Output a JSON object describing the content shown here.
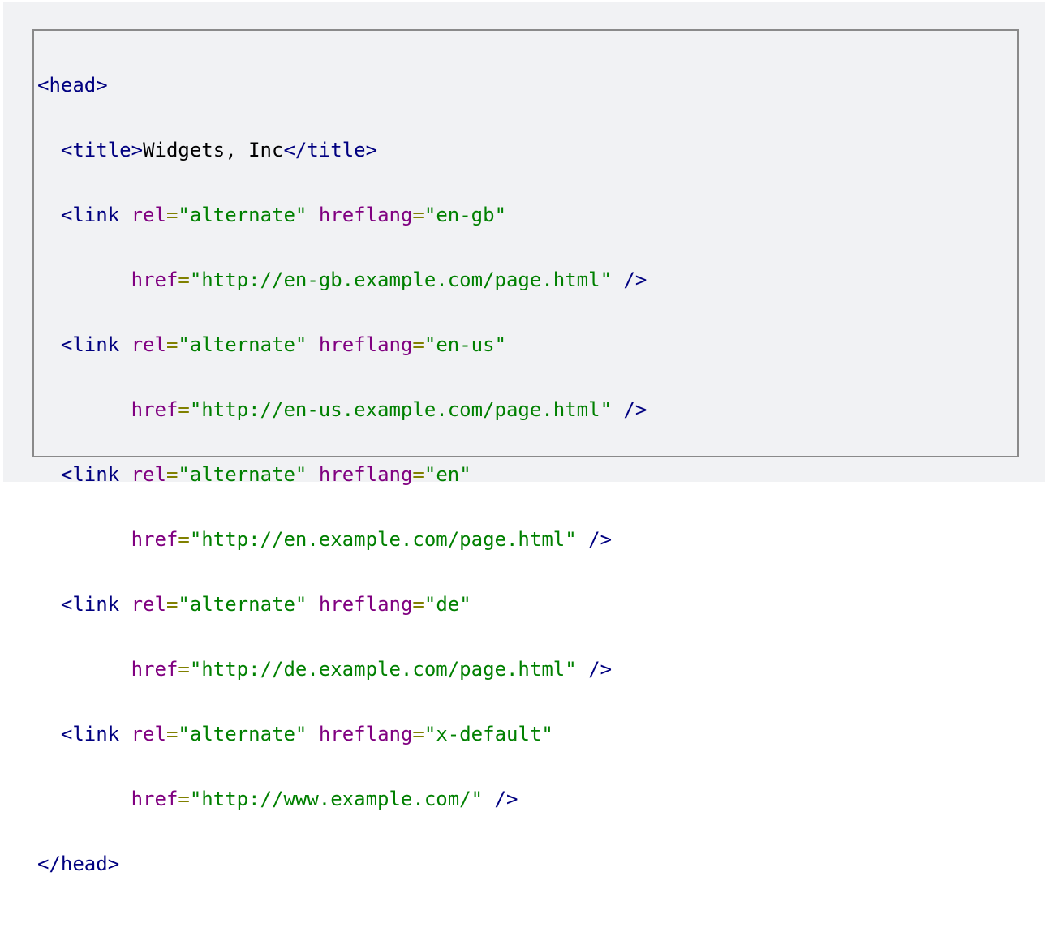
{
  "code": {
    "head_open": "<head>",
    "title_open": "<title>",
    "title_text": "Widgets, Inc",
    "title_close": "</title>",
    "head_close": "</head>",
    "link_open": "<link",
    "attr_rel": "rel",
    "attr_hreflang": "hreflang",
    "attr_href": "href",
    "equals": "=",
    "rel_value": "\"alternate\"",
    "self_close": "/>",
    "links": [
      {
        "hreflang": "\"en-gb\"",
        "href": "\"http://en-gb.example.com/page.html\""
      },
      {
        "hreflang": "\"en-us\"",
        "href": "\"http://en-us.example.com/page.html\""
      },
      {
        "hreflang": "\"en\"",
        "href": "\"http://en.example.com/page.html\""
      },
      {
        "hreflang": "\"de\"",
        "href": "\"http://de.example.com/page.html\""
      },
      {
        "hreflang": "\"x-default\"",
        "href": "\"http://www.example.com/\""
      }
    ]
  },
  "colors": {
    "tag": "#000080",
    "attribute": "#800080",
    "equals": "#808000",
    "string": "#008000",
    "text": "#000000",
    "background": "#f1f2f4",
    "border": "#8a8a8a"
  }
}
